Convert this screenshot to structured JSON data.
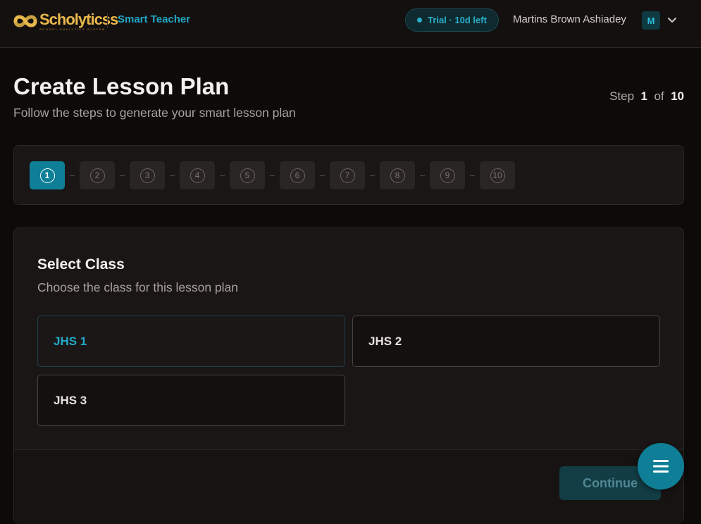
{
  "header": {
    "logo_word": "Scholyticss",
    "logo_tagline": "SCHOOL ANALYTICS SYSTEM",
    "app_name": "Smart Teacher",
    "trial_label": "Trial · 10d left",
    "user_name": "Martins Brown Ashiadey",
    "avatar_initial": "M"
  },
  "page": {
    "title": "Create Lesson Plan",
    "subtitle": "Follow the steps to generate your smart lesson plan",
    "step_prefix": "Step",
    "step_current": "1",
    "step_of": "of",
    "step_total": "10"
  },
  "stepper": {
    "steps": [
      "1",
      "2",
      "3",
      "4",
      "5",
      "6",
      "7",
      "8",
      "9",
      "10"
    ],
    "active_index": 0
  },
  "class_select": {
    "title": "Select Class",
    "subtitle": "Choose the class for this lesson plan",
    "options": [
      "JHS 1",
      "JHS 2",
      "JHS 3"
    ],
    "selected": "JHS 1"
  },
  "footer": {
    "continue_label": "Continue"
  },
  "colors": {
    "accent": "#0f7f97",
    "accent_text": "#22a9c8",
    "brand_gold": "#e8b84a",
    "background": "#0d0a0a"
  },
  "icons": {
    "logo": "scholyticss-logo-icon",
    "user_menu": "chevron-down-icon",
    "fab": "menu-icon"
  }
}
